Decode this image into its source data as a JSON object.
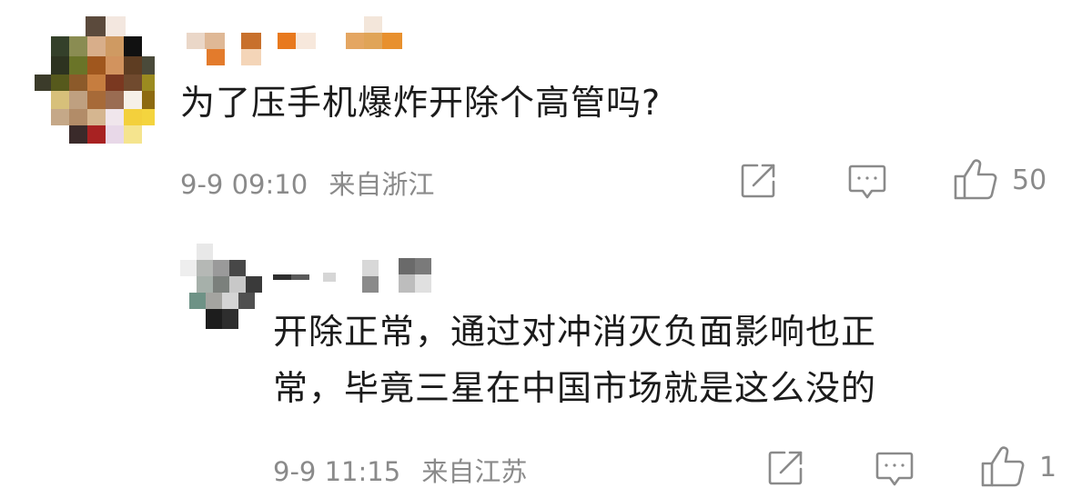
{
  "comments": [
    {
      "text": "为了压手机爆炸开除个高管吗?",
      "time": "9-9 09:10",
      "location": "来自浙江",
      "likes": "50",
      "actions": {
        "share_icon": "share-icon",
        "reply_icon": "comment-icon",
        "like_icon": "thumbs-up-icon"
      }
    },
    {
      "text_line1": "开除正常，通过对冲消灭负面影响也正",
      "text_line2": "常，毕竟三星在中国市场就是这么没的",
      "time": "9-9 11:15",
      "location": "来自江苏",
      "likes": "1",
      "actions": {
        "share_icon": "share-icon",
        "reply_icon": "comment-icon",
        "like_icon": "thumbs-up-icon"
      }
    }
  ],
  "colors": {
    "text": "#1b1b1b",
    "meta": "#8a8a8a",
    "background": "#ffffff"
  }
}
